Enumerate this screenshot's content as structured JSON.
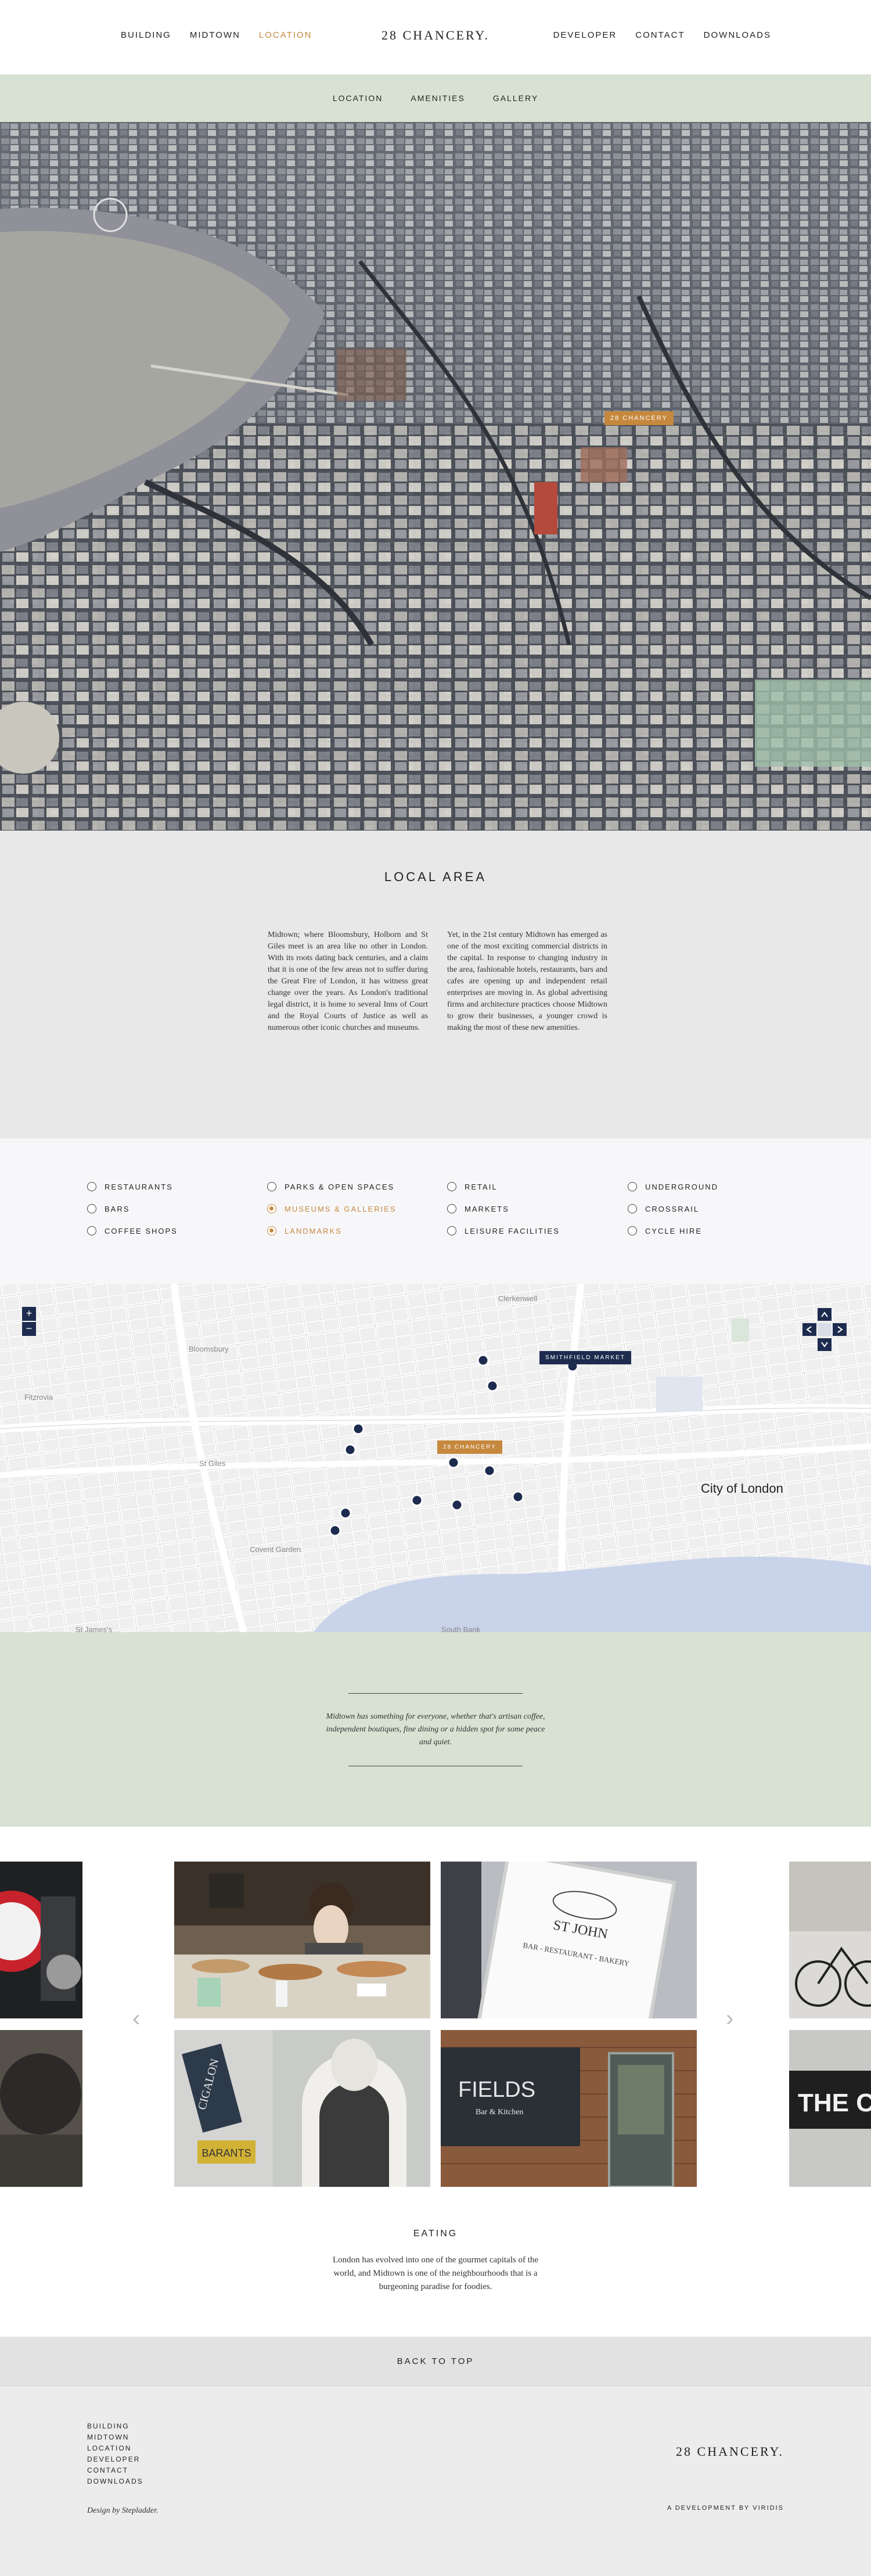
{
  "header": {
    "nav_left": [
      "Building",
      "Midtown",
      "Location"
    ],
    "brand": "28 CHANCERY.",
    "nav_right": [
      "Developer",
      "Contact",
      "Downloads"
    ],
    "active": "Location",
    "accent": "#c5883d"
  },
  "subnav": [
    "Location",
    "Amenities",
    "Gallery"
  ],
  "aerial": {
    "pin_label": "28 Chancery"
  },
  "local_area": {
    "title": "Local Area",
    "col1": "Midtown; where Bloomsbury, Holborn and St Giles meet is an area like no other in London. With its roots dating back centuries, and a claim that it is one of the few areas not to suffer during the Great Fire of London, it has witness great change over the years. As London's traditional legal district, it is home to several Inns of Court and the Royal Courts of Justice as well as numerous other iconic churches and museums.",
    "col2": "Yet, in the 21st century Midtown has emerged as one of the most exciting commercial districts in the capital. In response to changing industry in the area, fashionable hotels, restaurants, bars and cafes are opening up and independent retail enterprises are moving in. As global advertising firms and architecture practices choose Midtown to grow their businesses, a younger crowd is making the most of these new amenities."
  },
  "filters": [
    {
      "label": "Restaurants",
      "on": false
    },
    {
      "label": "Bars",
      "on": false
    },
    {
      "label": "Coffee Shops",
      "on": false
    },
    {
      "label": "Parks & Open Spaces",
      "on": false
    },
    {
      "label": "Museums & Galleries",
      "on": true
    },
    {
      "label": "Landmarks",
      "on": true
    },
    {
      "label": "Retail",
      "on": false
    },
    {
      "label": "Markets",
      "on": false
    },
    {
      "label": "Leisure Facilities",
      "on": false
    },
    {
      "label": "Underground",
      "on": false
    },
    {
      "label": "Crossrail",
      "on": false
    },
    {
      "label": "Cycle Hire",
      "on": false
    }
  ],
  "map": {
    "pin_main": "28 Chancery",
    "pin_market": "Smithfield Market",
    "labels": {
      "bloomsbury": "Bloomsbury",
      "clerkenwell": "Clerkenwell",
      "city": "City of London",
      "st_giles": "St Giles",
      "covent": "Covent Garden",
      "south_bank": "South Bank",
      "st_james": "St James's",
      "fitzrovia": "Fitzrovia"
    },
    "zoom_in": "+",
    "zoom_out": "−"
  },
  "quote": "Midtown has something for everyone, whether that's artisan coffee, independent boutiques, fine dining or a hidden spot for some peace and quiet.",
  "gallery": {
    "images": [
      "St John Bar - Restaurant - Bakery",
      "Fields Bar & Kitchen",
      "Cigalon",
      "Barants"
    ],
    "st_john_sign": "ST JOHN",
    "st_john_sub": "BAR - RESTAURANT - BAKERY",
    "fields": "FIELDS",
    "fields_sub": "Bar & Kitchen",
    "cigalon": "CIGALON",
    "barants": "BARANTS",
    "the": "THE C",
    "prev": "‹",
    "next": "›"
  },
  "eating": {
    "title": "Eating",
    "text": "London has evolved into one of the gourmet capitals of the world, and Midtown is one of the neighbourhoods that is a burgeoning paradise for foodies."
  },
  "back_to_top": "Back to top",
  "footer": {
    "links": [
      "Building",
      "Midtown",
      "Location",
      "Developer",
      "Contact",
      "Downloads"
    ],
    "credit": "Design by Stepladder.",
    "brand": "28 CHANCERY.",
    "dev": "A development by Viridis"
  }
}
